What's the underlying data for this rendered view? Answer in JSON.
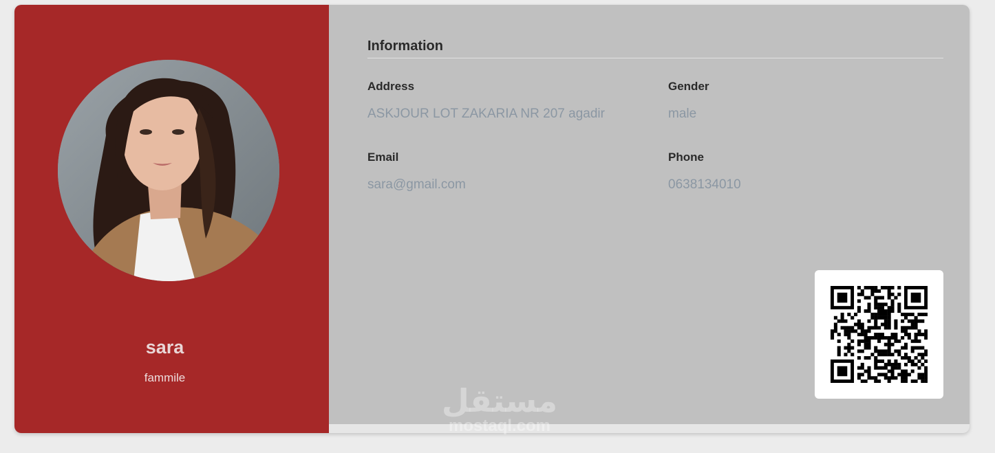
{
  "profile": {
    "name": "sara",
    "role": "fammile"
  },
  "information": {
    "title": "Information",
    "fields": [
      {
        "label": "Address",
        "value": "ASKJOUR LOT ZAKARIA NR 207 agadir"
      },
      {
        "label": "Gender",
        "value": "male"
      },
      {
        "label": "Email",
        "value": "sara@gmail.com"
      },
      {
        "label": "Phone",
        "value": "0638134010"
      }
    ]
  },
  "watermark": {
    "logo": "مستقل",
    "site": "mostaql.com"
  },
  "colors": {
    "accent": "#a62828",
    "panel": "#c0c0c0",
    "value_text": "#8b97a3"
  }
}
